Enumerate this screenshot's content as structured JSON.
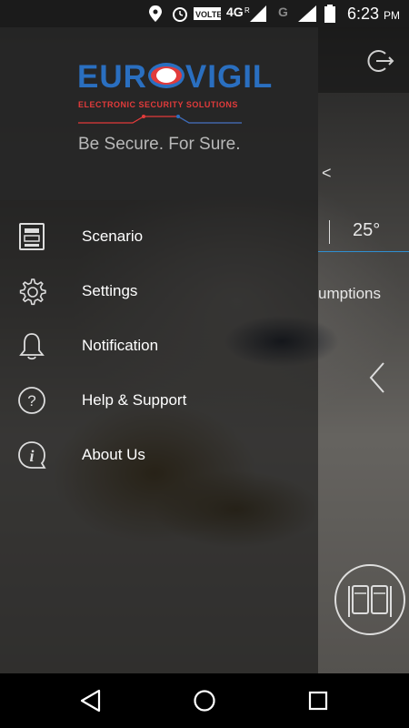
{
  "status_bar": {
    "time": "6:23",
    "ampm": "PM",
    "volte": "VOLTE",
    "network": "4G",
    "roaming": "R",
    "network2": "G",
    "icons": [
      "location-icon",
      "alarm-icon",
      "signal-icon",
      "battery-icon"
    ]
  },
  "logo": {
    "brand_left": "EUR",
    "brand_right": "VIGIL",
    "sub": "ELECTRONIC SECURITY SOLUTIONS",
    "tagline": "Be Secure. For Sure.",
    "brand_color": "#2a6fc0",
    "accent_color": "#e23b3b"
  },
  "menu": {
    "items": [
      {
        "label": "Scenario",
        "icon": "scenario-icon"
      },
      {
        "label": "Settings",
        "icon": "gear-icon"
      },
      {
        "label": "Notification",
        "icon": "bell-icon"
      },
      {
        "label": "Help & Support",
        "icon": "help-icon"
      },
      {
        "label": "About Us",
        "icon": "info-icon"
      }
    ]
  },
  "background": {
    "temperature": "25°",
    "consumption_partial": "umptions",
    "arrow_text": "<",
    "accent_color": "#2f8fd1"
  },
  "navbar": {
    "icons": [
      "back-icon",
      "home-icon",
      "recents-icon"
    ]
  }
}
